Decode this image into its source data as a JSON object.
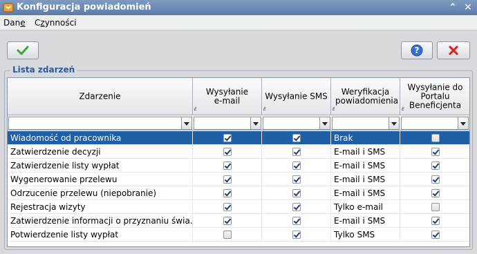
{
  "window": {
    "title": "Konfiguracja powiadomień"
  },
  "menu": [
    {
      "label": "Dane",
      "underline": "e"
    },
    {
      "label": "Czynności",
      "underline": "z"
    }
  ],
  "colors": {
    "titlebar": "#6a8ab4",
    "selection": "#1e5fa6",
    "group_title": "#2a5a9e",
    "cancel": "#d62a2a",
    "confirm": "#3aa53a",
    "help": "#3a6fd0"
  },
  "toolbar": {
    "confirm_icon": "check-icon",
    "help_icon": "question-icon",
    "cancel_icon": "x-icon"
  },
  "group": {
    "title": "Lista zdarzeń"
  },
  "table": {
    "columns": [
      "Zdarzenie",
      "Wysyłanie e-mail",
      "Wysyłanie SMS",
      "Weryfikacja powiadomienia",
      "Wysyłanie do Portalu Beneficjenta"
    ],
    "header_marker": "E",
    "rows": [
      {
        "event": "Wiadomość od pracownika",
        "email": true,
        "sms": true,
        "verification": "Brak",
        "portal": false,
        "selected": true
      },
      {
        "event": "Zatwierdzenie decyzji",
        "email": true,
        "sms": true,
        "verification": "E-mail i SMS",
        "portal": true
      },
      {
        "event": "Zatwierdzenie listy wypłat",
        "email": true,
        "sms": true,
        "verification": "E-mail i SMS",
        "portal": true
      },
      {
        "event": "Wygenerowanie przelewu",
        "email": true,
        "sms": true,
        "verification": "E-mail i SMS",
        "portal": true
      },
      {
        "event": "Odrzucenie przelewu (niepobranie)",
        "email": true,
        "sms": true,
        "verification": "E-mail i SMS",
        "portal": true
      },
      {
        "event": "Rejestracja wizyty",
        "email": true,
        "sms": true,
        "verification": "Tylko e-mail",
        "portal": false
      },
      {
        "event": "Zatwierdzenie informacji o przyznaniu świa…",
        "email": true,
        "sms": true,
        "verification": "E-mail i SMS",
        "portal": true
      },
      {
        "event": "Potwierdzenie listy wypłat",
        "email": false,
        "sms": true,
        "verification": "Tylko SMS",
        "portal": true
      }
    ]
  }
}
